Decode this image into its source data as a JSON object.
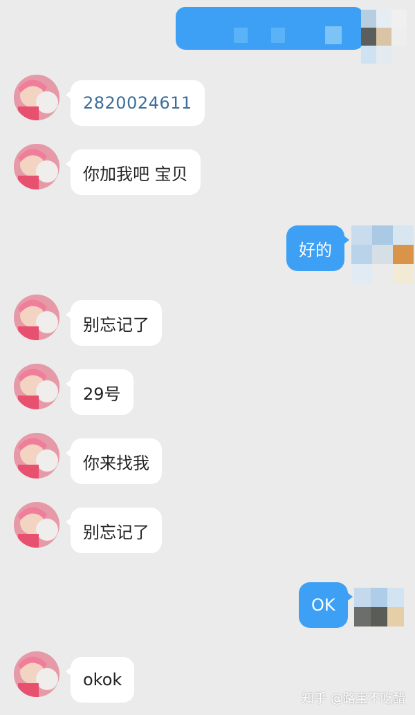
{
  "messages": [
    {
      "side": "out",
      "text": ""
    },
    {
      "side": "in",
      "text": "2820024611"
    },
    {
      "side": "in",
      "text": "你加我吧 宝贝"
    },
    {
      "side": "out",
      "text": "好的"
    },
    {
      "side": "in",
      "text": "别忘记了"
    },
    {
      "side": "in",
      "text": "29号"
    },
    {
      "side": "in",
      "text": "你来找我"
    },
    {
      "side": "in",
      "text": "别忘记了"
    },
    {
      "side": "out",
      "text": "OK"
    },
    {
      "side": "in",
      "text": "okok"
    }
  ],
  "watermark": "知乎 @路宝不吃醋",
  "colors": {
    "background": "#ebebeb",
    "outgoing_bubble": "#3ea0f5",
    "incoming_bubble": "#ffffff",
    "number_text": "#3b6e9c"
  }
}
